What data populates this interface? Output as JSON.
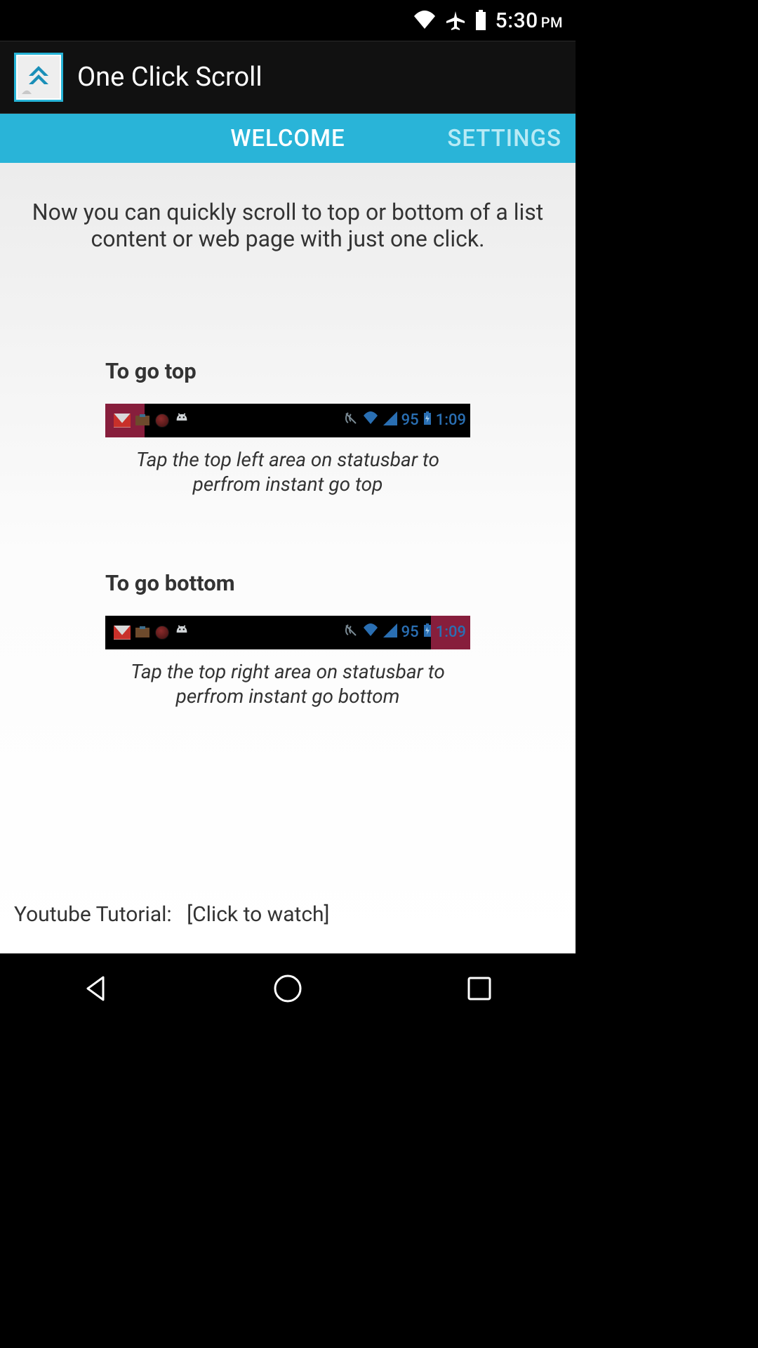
{
  "status_bar": {
    "time": "5:30",
    "period": "PM"
  },
  "action_bar": {
    "title": "One Click Scroll"
  },
  "tabs": {
    "welcome": "WELCOME",
    "settings": "SETTINGS"
  },
  "content": {
    "intro": "Now you can quickly scroll to top or bottom of a list content or web page with just one click.",
    "go_top": {
      "title": "To go top",
      "mock_batt_pct": "95",
      "mock_time": "1:09",
      "caption": "Tap the top left area on statusbar to perfrom instant go top"
    },
    "go_bottom": {
      "title": "To go bottom",
      "mock_batt_pct": "95",
      "mock_time": "1:09",
      "caption": "Tap the top right area on statusbar to perfrom instant go bottom"
    },
    "tutorial_label": "Youtube Tutorial:",
    "tutorial_link": "[Click to watch]"
  }
}
